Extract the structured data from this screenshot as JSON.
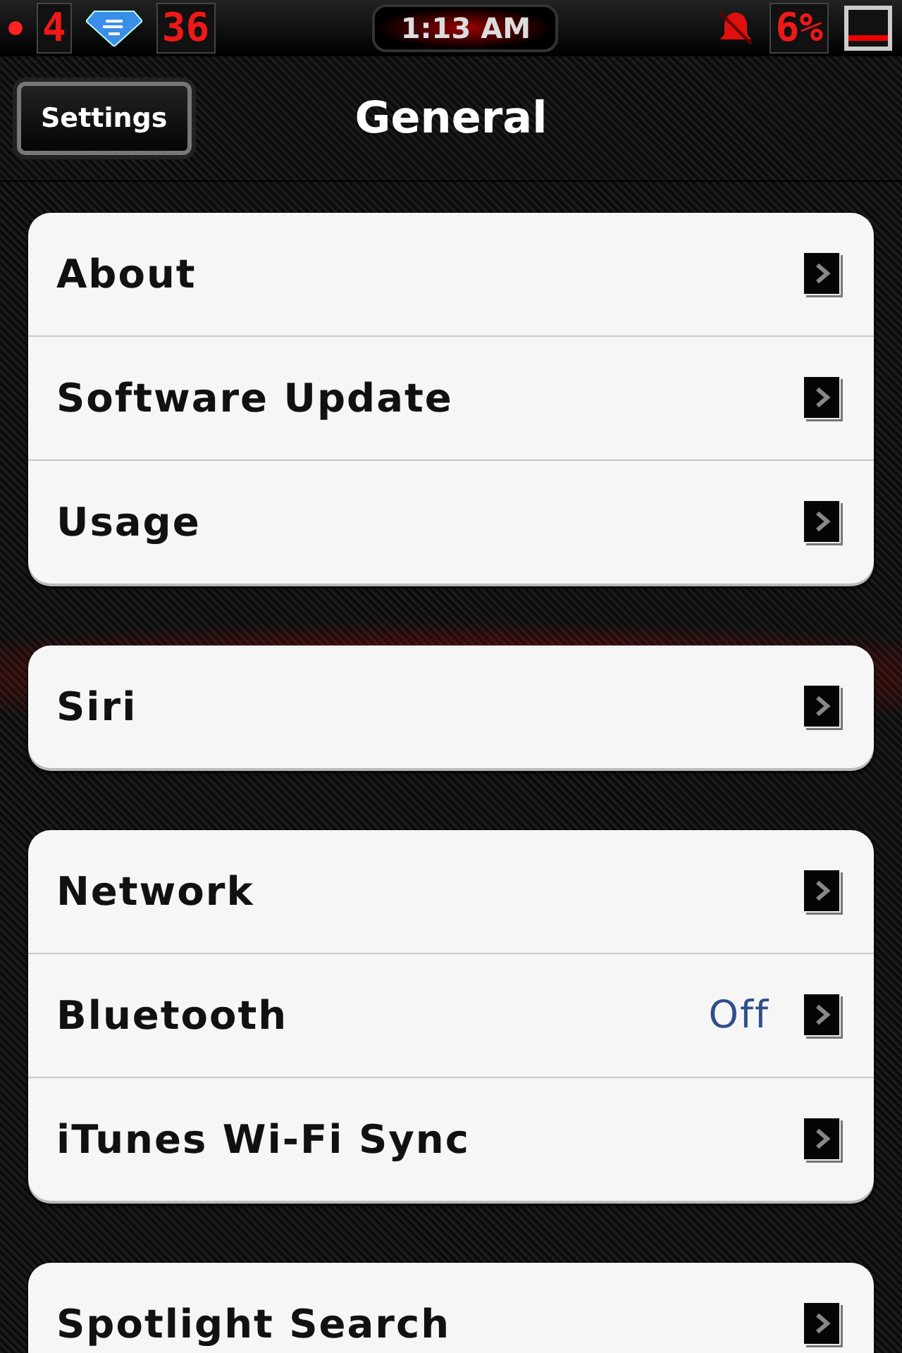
{
  "status_bar": {
    "left_digit": "4",
    "left_count": "36",
    "time": "1:13 AM",
    "battery": "6%"
  },
  "nav_bar": {
    "back_button": "Settings",
    "title": "General"
  },
  "groups": [
    {
      "rows": [
        {
          "label": "About"
        },
        {
          "label": "Software Update"
        },
        {
          "label": "Usage"
        }
      ]
    },
    {
      "rows": [
        {
          "label": "Siri"
        }
      ]
    },
    {
      "rows": [
        {
          "label": "Network"
        },
        {
          "label": "Bluetooth",
          "value": "Off"
        },
        {
          "label": "iTunes Wi-Fi Sync"
        }
      ]
    },
    {
      "rows": [
        {
          "label": "Spotlight Search"
        }
      ]
    }
  ]
}
